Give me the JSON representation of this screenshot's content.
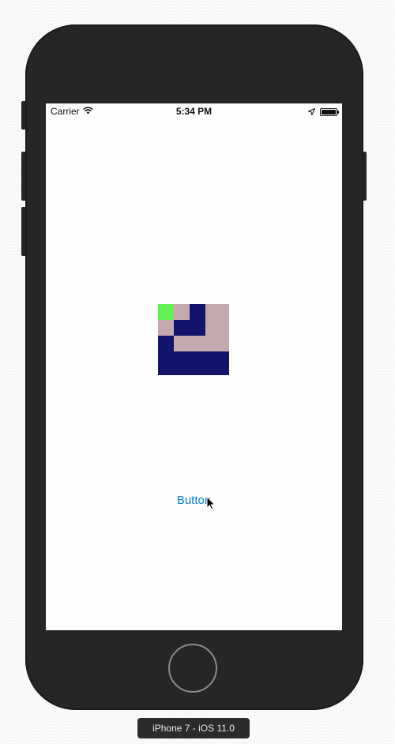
{
  "status_bar": {
    "carrier": "Carrier",
    "time": "5:34 PM",
    "icons": [
      "wifi-icon",
      "location-arrow-icon",
      "battery-icon"
    ]
  },
  "main": {
    "button_label": "Button",
    "pattern_colors": {
      "green": "#66ee55",
      "pink": "#c4aaaf",
      "navy": "#12136a"
    }
  },
  "device": {
    "label": "iPhone 7 - iOS 11.0"
  },
  "colors": {
    "accent": "#0a84d6",
    "device_body": "#262626",
    "screen": "#fdfdfd"
  }
}
